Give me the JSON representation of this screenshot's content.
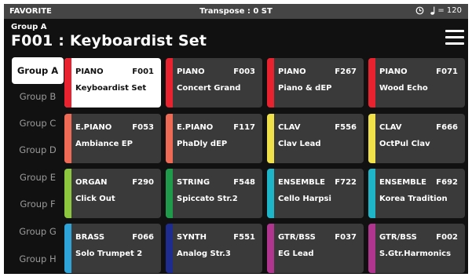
{
  "statusbar": {
    "left": "FAVORITE",
    "center": "Transpose : 0 ST",
    "tempo": "= 120"
  },
  "header": {
    "group": "Group A",
    "title": "F001 : Keyboardist Set"
  },
  "groups": [
    "Group A",
    "Group B",
    "Group C",
    "Group D",
    "Group E",
    "Group F",
    "Group G",
    "Group H"
  ],
  "selected_group": "Group A",
  "colors": {
    "piano": "#e8232f",
    "epiano": "#ee6a55",
    "clav": "#f0e14a",
    "organ": "#8cc63e",
    "string": "#1f9a4a",
    "ensemble": "#1fb5c8",
    "brass": "#2ea3d8",
    "synth": "#1f2c8f",
    "gtrbss": "#b0358f"
  },
  "tiles": [
    {
      "category": "PIANO",
      "number": "F001",
      "name": "Keyboardist Set",
      "color": "#e8232f",
      "selected": true
    },
    {
      "category": "PIANO",
      "number": "F003",
      "name": "Concert Grand",
      "color": "#e8232f"
    },
    {
      "category": "PIANO",
      "number": "F267",
      "name": "Piano & dEP",
      "color": "#e8232f"
    },
    {
      "category": "PIANO",
      "number": "F071",
      "name": "Wood Echo",
      "color": "#e8232f"
    },
    {
      "category": "E.PIANO",
      "number": "F053",
      "name": "Ambiance EP",
      "color": "#ee6a55"
    },
    {
      "category": "E.PIANO",
      "number": "F117",
      "name": "PhaDly dEP",
      "color": "#ee6a55"
    },
    {
      "category": "CLAV",
      "number": "F556",
      "name": "Clav Lead",
      "color": "#f0e14a"
    },
    {
      "category": "CLAV",
      "number": "F666",
      "name": "OctPul Clav",
      "color": "#f0e14a"
    },
    {
      "category": "ORGAN",
      "number": "F290",
      "name": "Click Out",
      "color": "#8cc63e"
    },
    {
      "category": "STRING",
      "number": "F548",
      "name": "Spiccato Str.2",
      "color": "#1f9a4a"
    },
    {
      "category": "ENSEMBLE",
      "number": "F722",
      "name": "Cello Harpsi",
      "color": "#1fb5c8"
    },
    {
      "category": "ENSEMBLE",
      "number": "F692",
      "name": "Korea Tradition",
      "color": "#1fb5c8"
    },
    {
      "category": "BRASS",
      "number": "F066",
      "name": "Solo Trumpet 2",
      "color": "#2ea3d8"
    },
    {
      "category": "SYNTH",
      "number": "F551",
      "name": "Analog Str.3",
      "color": "#1f2c8f"
    },
    {
      "category": "GTR/BSS",
      "number": "F037",
      "name": "EG Lead",
      "color": "#b0358f"
    },
    {
      "category": "GTR/BSS",
      "number": "F002",
      "name": "S.Gtr.Harmonics",
      "color": "#b0358f"
    }
  ]
}
